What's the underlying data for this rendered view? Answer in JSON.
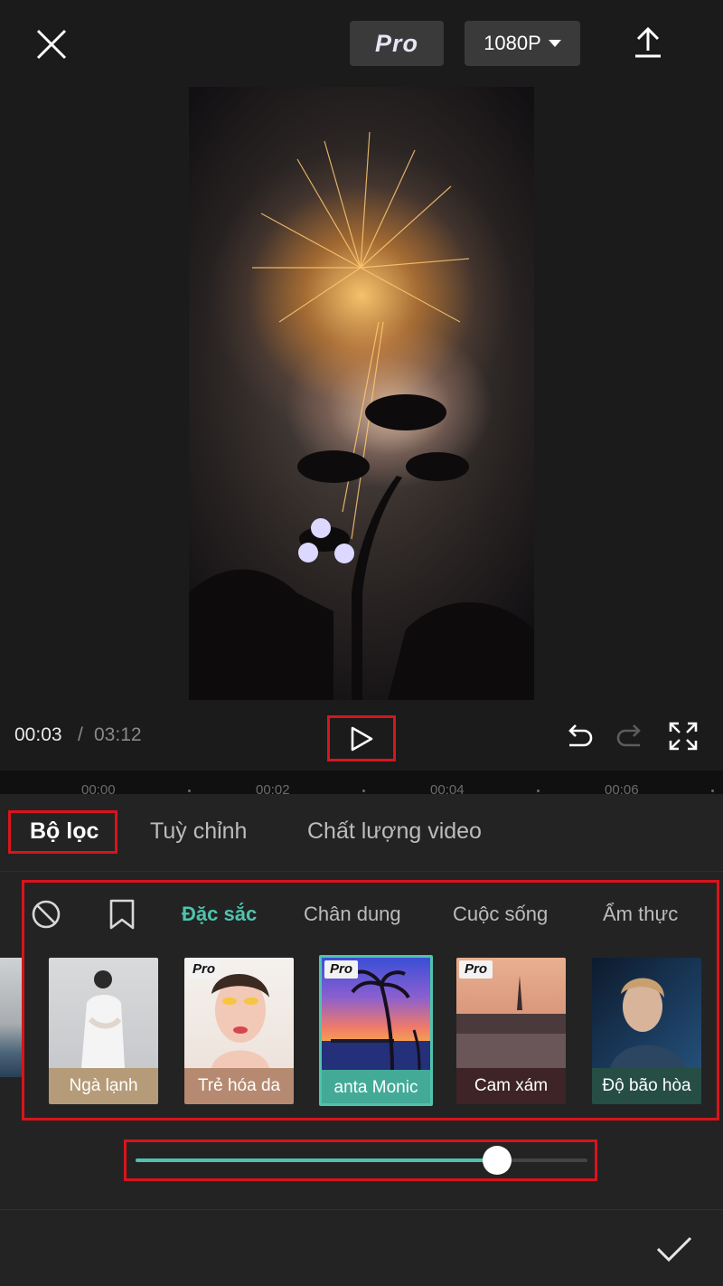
{
  "header": {
    "pro_label": "Pro",
    "resolution": "1080P"
  },
  "playback": {
    "current_time": "00:03",
    "separator": "/",
    "total_time": "03:12"
  },
  "timeline": {
    "ticks": [
      "00:00",
      "00:02",
      "00:04",
      "00:06"
    ]
  },
  "tabs": [
    {
      "label": "Bộ lọc"
    },
    {
      "label": "Tuỳ chỉnh"
    },
    {
      "label": "Chất lượng video"
    }
  ],
  "filter_categories": [
    {
      "label": "Đặc sắc"
    },
    {
      "label": "Chân dung"
    },
    {
      "label": "Cuộc sống"
    },
    {
      "label": "Ẩm thực"
    }
  ],
  "filters": [
    {
      "label": "Ngà lạnh",
      "pro": false
    },
    {
      "label": "Trẻ hóa da",
      "pro": true,
      "badge": "Pro"
    },
    {
      "label": "anta Monic",
      "pro": true,
      "badge": "Pro"
    },
    {
      "label": "Cam xám",
      "pro": true,
      "badge": "Pro"
    },
    {
      "label": "Độ bão hòa",
      "pro": false
    }
  ],
  "intensity": {
    "value": 0.8
  },
  "colors": {
    "accent": "#4fc3ae",
    "highlight_box": "#d8141c",
    "background": "#1b1b1b",
    "panel": "#232323"
  },
  "icons": {
    "close": "close-icon",
    "export": "upload-icon",
    "play": "play-icon",
    "undo": "undo-icon",
    "redo": "redo-icon",
    "fullscreen": "fullscreen-icon",
    "none_filter": "prohibited-icon",
    "bookmark": "bookmark-icon",
    "confirm": "checkmark-icon"
  }
}
